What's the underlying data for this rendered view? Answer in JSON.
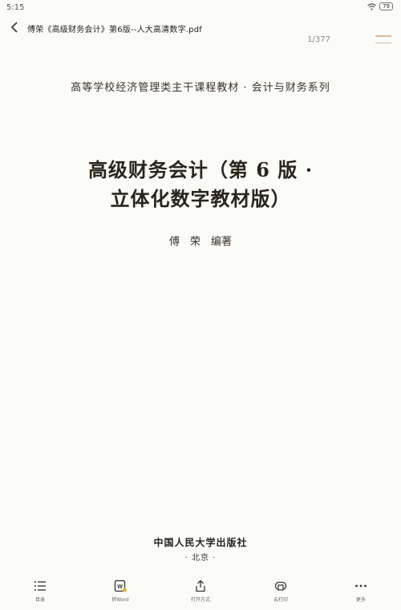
{
  "status": {
    "time": "5:15",
    "battery": "79"
  },
  "header": {
    "title": "傅荣《高级财务会计》第6版--人大高清数字.pdf",
    "page_indicator": "1/377"
  },
  "page": {
    "series": "高等学校经济管理类主干课程教材 · 会计与财务系列",
    "title_line1": "高级财务会计（第 6 版 ·",
    "title_line2": "立体化数字教材版）",
    "author": "傅　荣　编著",
    "publisher": "中国人民大学出版社",
    "city": "· 北京 ·"
  },
  "toolbar": {
    "items": [
      {
        "label": "目录",
        "icon": "list-icon"
      },
      {
        "label": "转Word",
        "icon": "word-icon"
      },
      {
        "label": "打开方式",
        "icon": "share-icon"
      },
      {
        "label": "云打印",
        "icon": "printer-icon"
      },
      {
        "label": "更多",
        "icon": "more-icon"
      }
    ]
  }
}
